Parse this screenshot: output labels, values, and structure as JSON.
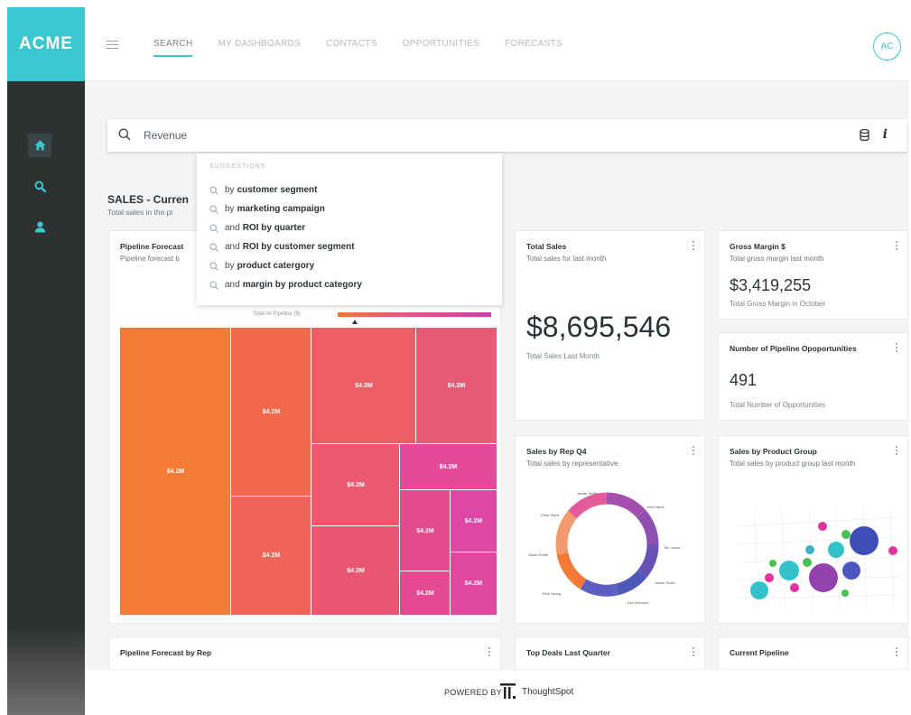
{
  "app": {
    "logo_text": "ACME"
  },
  "nav": {
    "items": [
      "SEARCH",
      "MY DASHBOARDS",
      "CONTACTS",
      "OPPORTUNITIES",
      "FORECASTS"
    ],
    "active": "SEARCH"
  },
  "user": {
    "initials": "AC"
  },
  "search": {
    "value": "Revenue",
    "suggestions_title": "SUGGESTIONS",
    "suggestions": [
      {
        "prefix": "by",
        "bold": "customer segment"
      },
      {
        "prefix": "by",
        "bold": "marketing campaign"
      },
      {
        "prefix": "and",
        "bold": "ROI by quarter"
      },
      {
        "prefix": "and",
        "bold": "ROI by customer segment"
      },
      {
        "prefix": "by",
        "bold": "product catergory"
      },
      {
        "prefix": "and",
        "bold": "margin by product category"
      }
    ]
  },
  "section": {
    "title": "SALES - Curren",
    "subtitle": "Total sales in the pi"
  },
  "cards": {
    "pipeline_forecast": {
      "title": "Pipeline Forecast",
      "subtitle": "Pipeline forecast b",
      "legend_label": "Total All Pipeline ($)"
    },
    "total_sales": {
      "title": "Total Sales",
      "subtitle": "Total sales for last month",
      "value": "$8,695,546",
      "caption": "Total Sales Last Month"
    },
    "gross_margin": {
      "title": "Gross Margin $",
      "subtitle": "Total gross margin last month",
      "value": "$3,419,255",
      "caption": "Total Gross Margin in October"
    },
    "pipeline_opps": {
      "title": "Number of Pipeline Opoportunities",
      "value": "491",
      "caption": "Total Number of Opportunities"
    },
    "sales_by_rep": {
      "title": "Sales by Rep Q4",
      "subtitle": "Total sales by representative",
      "reps": [
        "Jackie Smith",
        "Kim Harris",
        "Tim Jones",
        "Jackie Smith",
        "Ken Breedon",
        "Rick Young",
        "Sarah Smith",
        "Peter Ward"
      ]
    },
    "sales_by_product": {
      "title": "Sales by Product Group",
      "subtitle": "Total sales by product group last month"
    },
    "pipeline_by_rep": {
      "title": "Pipeline Forecast by Rep"
    },
    "top_deals": {
      "title": "Top Deals Last Quarter"
    },
    "current_pipeline": {
      "title": "Current Pipeline"
    }
  },
  "treemap": {
    "cell_label": "$4.2M",
    "colors": [
      "#f47a37",
      "#f2684a",
      "#ef5e67",
      "#e85a76",
      "#e44a9a",
      "#e34b8c",
      "#df46a6"
    ]
  },
  "footer": {
    "powered_by": "POWERED BY",
    "brand": "ThoughtSpot"
  },
  "colors": {
    "accent": "#3cc6cf",
    "sidebar": "#2e3132"
  }
}
